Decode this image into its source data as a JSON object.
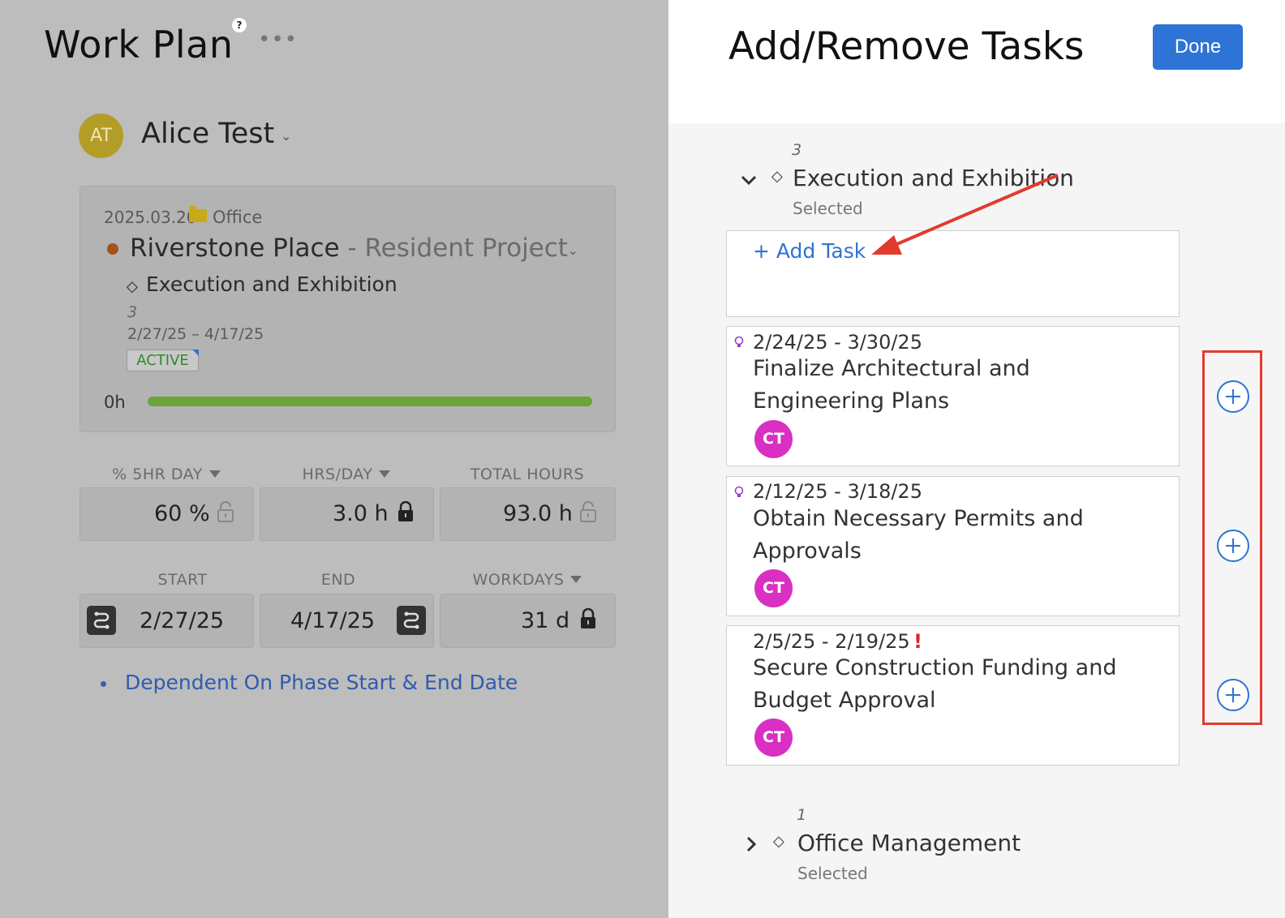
{
  "left": {
    "title": "Work Plan",
    "help_glyph": "?",
    "more_glyph": "•••",
    "user": {
      "initials": "AT",
      "name": "Alice Test",
      "chevron": "⌄"
    },
    "card": {
      "date": "2025.03.20",
      "office": "Office",
      "project": "Riverstone Place",
      "separator": " - ",
      "project_sub": "Resident Project",
      "chevron": "⌄",
      "phase_icon": "◇",
      "phase": "Execution and Exhibition",
      "phase_number": "3",
      "phase_dates": "2/27/25 – 4/17/25",
      "status": "ACTIVE",
      "hours": "0h"
    },
    "fields_row1": {
      "pct_label": "% 5HR DAY",
      "pct_value": "60 %",
      "hrs_label": "HRS/DAY",
      "hrs_value": "3.0 h",
      "total_label": "TOTAL HOURS",
      "total_value": "93.0 h"
    },
    "fields_row2": {
      "start_label": "START",
      "start_value": "2/27/25",
      "end_label": "END",
      "end_value": "4/17/25",
      "workdays_label": "WORKDAYS",
      "workdays_value": "31 d"
    },
    "dependency_link": "Dependent On Phase Start & End Date"
  },
  "right": {
    "title": "Add/Remove Tasks",
    "done_label": "Done",
    "phase1": {
      "number": "3",
      "icon": "◇",
      "title": "Execution and Exhibition",
      "status": "Selected",
      "chevron": "⌄"
    },
    "add_task_label": "+ Add Task",
    "tasks": [
      {
        "dates": "2/24/25 - 3/30/25",
        "title": "Finalize Architectural and Engineering Plans",
        "assignee": "CT",
        "marker": "bulb"
      },
      {
        "dates": "2/12/25 - 3/18/25",
        "title": "Obtain Necessary Permits and Approvals",
        "assignee": "CT",
        "marker": "bulb"
      },
      {
        "dates": "2/5/25 - 2/19/25",
        "title": "Secure Construction Funding and Budget Approval",
        "assignee": "CT",
        "marker": "alert",
        "alert_glyph": "!"
      }
    ],
    "phase2": {
      "number": "1",
      "icon": "◇",
      "title": "Office Management",
      "status": "Selected",
      "chevron": "›"
    }
  },
  "colors": {
    "accent": "#2e73d6",
    "active_green": "#2e8b2e",
    "progress_green": "#6aa43a",
    "annotation_red": "#e23b2e",
    "assignee_pink": "#d92fc3",
    "user_avatar": "#b49d27"
  },
  "icons": {
    "lock_open": "unlock-icon",
    "lock_closed": "lock-icon",
    "range": "date-range-icon",
    "plus": "add-circle-icon",
    "bulb": "lightbulb-icon",
    "folder": "folder-icon"
  }
}
